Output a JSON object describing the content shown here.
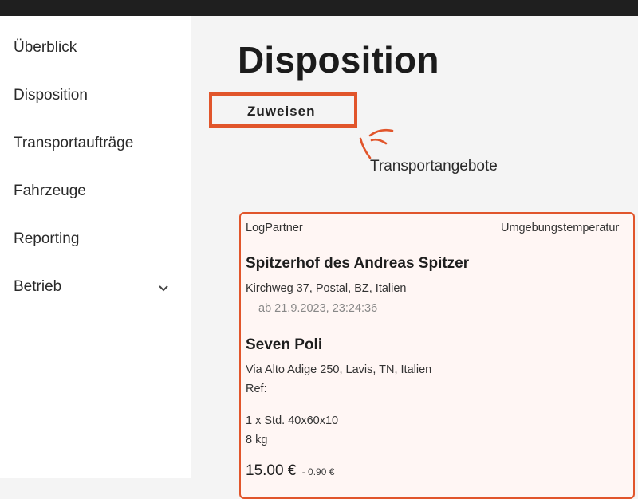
{
  "sidebar": {
    "items": [
      {
        "label": "Überblick"
      },
      {
        "label": "Disposition"
      },
      {
        "label": "Transportaufträge"
      },
      {
        "label": "Fahrzeuge"
      },
      {
        "label": "Reporting"
      },
      {
        "label": "Betrieb",
        "expand_icon": "chevron-down-icon"
      }
    ]
  },
  "main": {
    "title": "Disposition",
    "tabs": [
      {
        "label": "Zuweisen",
        "selected": true
      },
      {
        "label": "Transportangebote",
        "selected": false
      }
    ]
  },
  "card": {
    "partner_label": "LogPartner",
    "temperature_label": "Umgebungstemperatur",
    "pickup": {
      "name": "Spitzerhof des Andreas Spitzer",
      "address": "Kirchweg 37, Postal, BZ, Italien",
      "time": "ab 21.9.2023, 23:24:36"
    },
    "delivery": {
      "name": "Seven Poli",
      "address": "Via Alto Adige 250, Lavis, TN, Italien",
      "ref": "Ref:"
    },
    "cargo": {
      "quantity": "1 x Std. 40x60x10",
      "weight": "8 kg"
    },
    "price": "15.00 €",
    "discount": "- 0.90 €"
  },
  "colors": {
    "accent": "#e1552b",
    "sidebar_bg": "#ffffff",
    "main_bg": "#f4f4f4",
    "topbar": "#1f1f1f"
  }
}
